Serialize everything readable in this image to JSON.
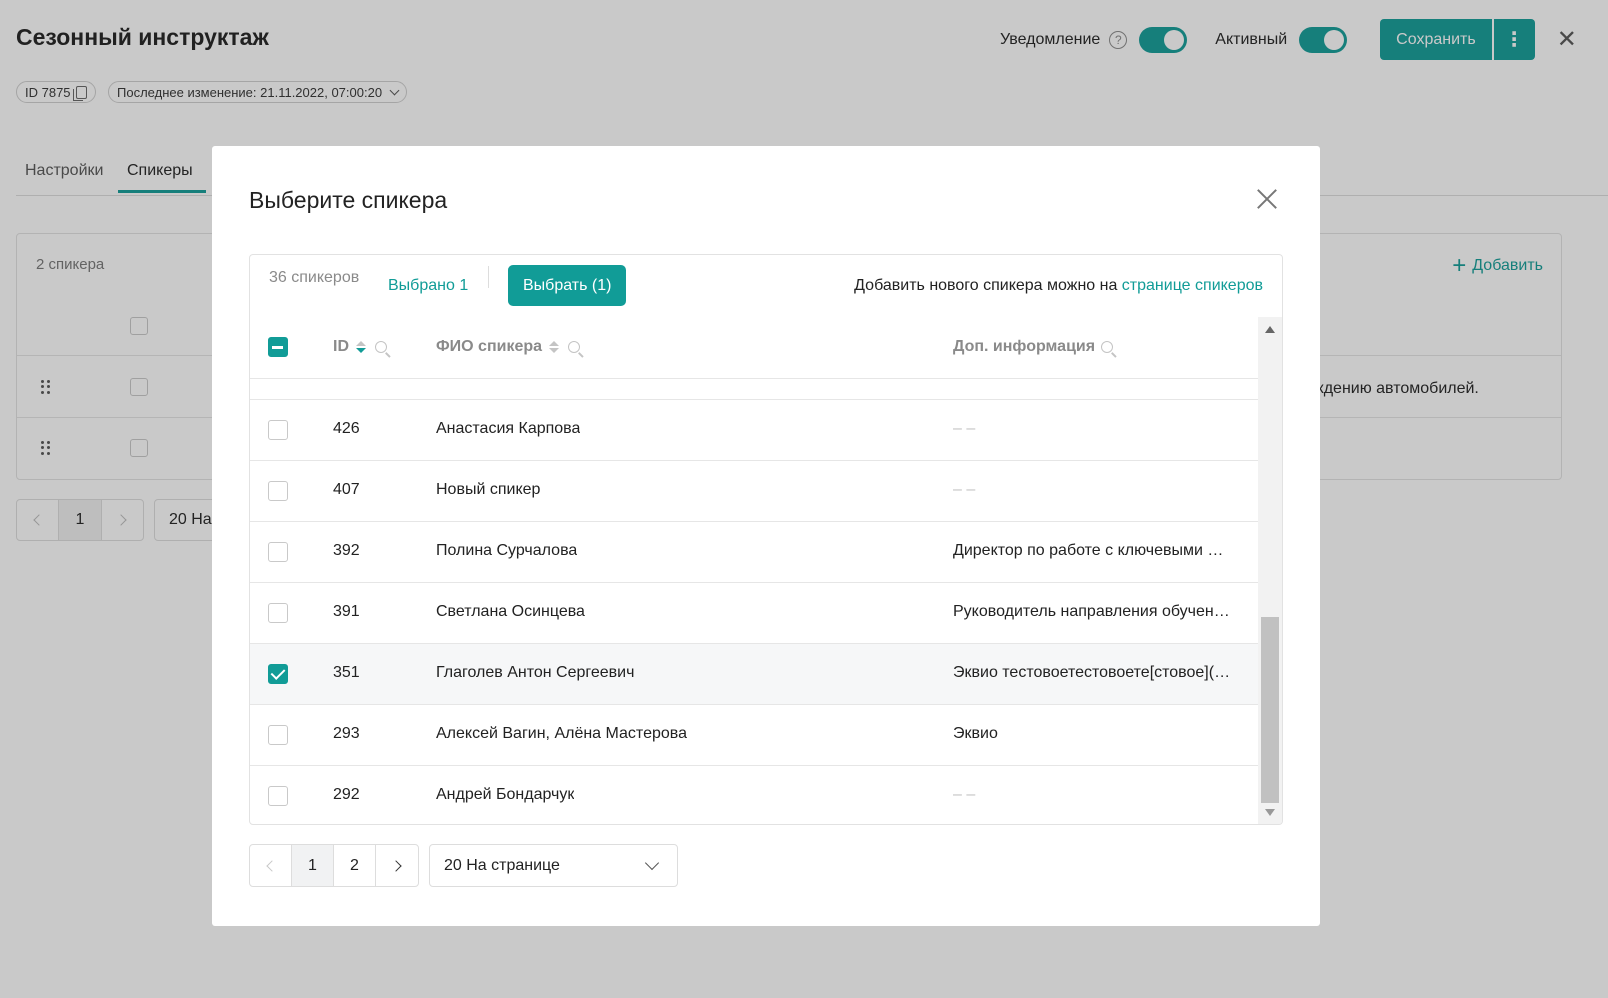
{
  "page": {
    "title": "Сезонный инструктаж",
    "notification_label": "Уведомление",
    "active_label": "Активный",
    "save_label": "Сохранить",
    "id_chip": "ID 7875",
    "last_change": "Последнее изменение: 21.11.2022, 07:00:20",
    "tabs": [
      {
        "label": "Настройки",
        "active": false
      },
      {
        "label": "Спикеры",
        "active": true
      }
    ],
    "speakers_count": "2 спикера",
    "add_label": "Добавить",
    "row_text_partial": "ждению автомобилей.",
    "pager_current": "1",
    "per_page_partial": "20 На"
  },
  "colors": {
    "accent": "#119c97",
    "overlay": "rgba(40,40,40,0.25)"
  },
  "modal": {
    "title": "Выберите спикера",
    "total": "36 спикеров",
    "selected": "Выбрано 1",
    "choose_button": "Выбрать (1)",
    "hint_text": "Добавить нового спикера можно на ",
    "hint_link": "странице спикеров",
    "columns": {
      "id": "ID",
      "name": "ФИО спикера",
      "info": "Доп. информация"
    },
    "rows": [
      {
        "id": "426",
        "name": "Анастасия Карпова",
        "info": "– –",
        "checked": false
      },
      {
        "id": "407",
        "name": "Новый спикер",
        "info": "– –",
        "checked": false
      },
      {
        "id": "392",
        "name": "Полина Сурчалова",
        "info": "Директор по работе с ключевыми …",
        "checked": false
      },
      {
        "id": "391",
        "name": "Светлана Осинцева",
        "info": "Руководитель направления обучен…",
        "checked": false
      },
      {
        "id": "351",
        "name": "Глаголев Антон Сергеевич",
        "info": "Эквио тестовоетестовоете[стовое](…",
        "checked": true
      },
      {
        "id": "293",
        "name": "Алексей Вагин, Алёна Мастерова",
        "info": "Эквио",
        "checked": false
      },
      {
        "id": "292",
        "name": "Андрей Бондарчук",
        "info": "– –",
        "checked": false
      }
    ],
    "pagination": {
      "pages": [
        "1",
        "2"
      ],
      "current": "1",
      "per_page": "20 На странице"
    }
  }
}
